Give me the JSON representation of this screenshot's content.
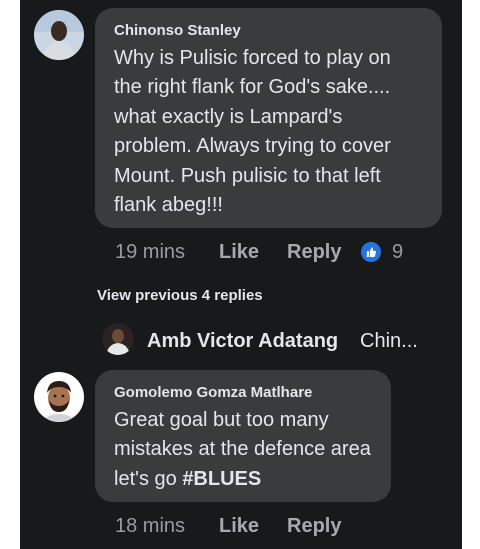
{
  "comments": [
    {
      "author": "Chinonso Stanley",
      "text_lines": [
        "Why is Pulisic forced to play on",
        "the right flank for God's sake....",
        "what exactly is Lampard's",
        "problem. Always trying to cover",
        "Mount. Push pulisic to that left",
        "flank abeg!!!"
      ],
      "time": "19 mins",
      "like_label": "Like",
      "reply_label": "Reply",
      "reaction_count": "9",
      "reaction_icon": "thumbs-up-icon"
    },
    {
      "author": "Gomolemo Gomza Matlhare",
      "text_lines": [
        "Great goal but too many",
        "mistakes at the defence area"
      ],
      "text_last_prefix": "let's go ",
      "text_last_hashtag": "#BLUES",
      "time": "18 mins",
      "like_label": "Like",
      "reply_label": "Reply"
    }
  ],
  "view_previous_replies": "View previous 4 replies",
  "reply_preview": {
    "author": "Amb Victor Adatang",
    "snippet": "Chin..."
  },
  "colors": {
    "panel_bg": "#18191a",
    "bubble_bg": "#3a3b3c",
    "text": "#e4e6eb",
    "meta": "#9a9ba0",
    "like_blue": "#2374e1"
  }
}
